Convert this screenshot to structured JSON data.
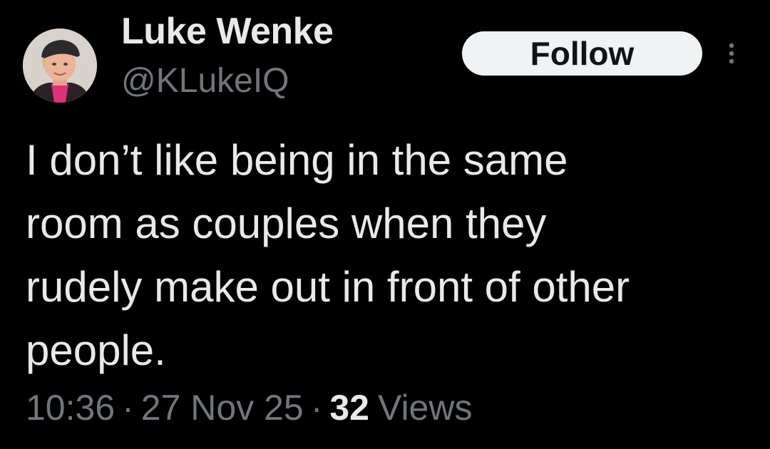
{
  "author": {
    "display_name": "Luke Wenke",
    "handle": "@KLukeIQ"
  },
  "actions": {
    "follow_label": "Follow",
    "more_icon": "more-vertical-icon"
  },
  "tweet": {
    "text": "I don’t like being in the same\nroom as couples when they\nrudely make out in front of other\npeople."
  },
  "meta": {
    "time": "10:36",
    "separator": "·",
    "date": "27 Nov 25",
    "views_count": "32",
    "views_label": "Views"
  },
  "colors": {
    "background": "#000000",
    "primary_text": "#e7e9ea",
    "secondary_text": "#71767b",
    "follow_button_bg": "#eff3f4",
    "follow_button_text": "#0f1419"
  }
}
